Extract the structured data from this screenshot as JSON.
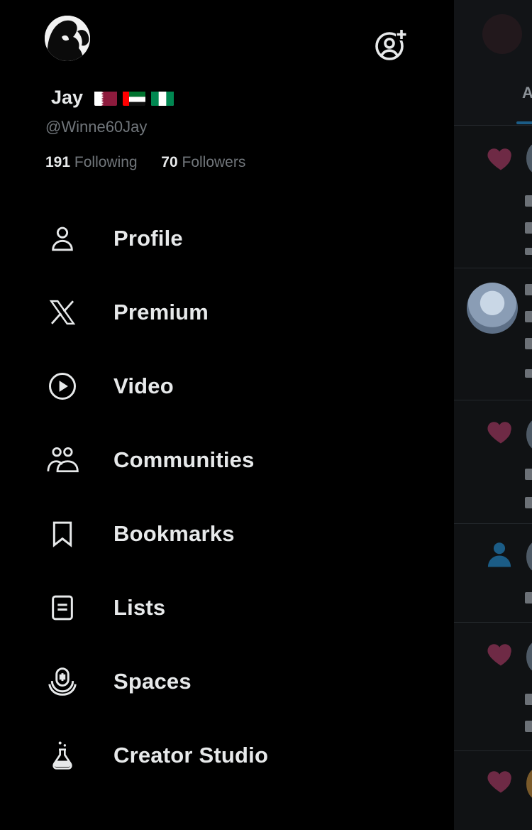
{
  "profile": {
    "display_name_parts": [
      "",
      "Jay",
      ""
    ],
    "handle": "@Winne60Jay",
    "following_count": "191",
    "following_label": "Following",
    "followers_count": "70",
    "followers_label": "Followers"
  },
  "flags": [
    "qatar",
    "uae",
    "nigeria"
  ],
  "header": {
    "add_account_icon": "person-add-icon"
  },
  "menu": [
    {
      "label": "Profile",
      "icon": "person-icon"
    },
    {
      "label": "Premium",
      "icon": "x-logo-icon"
    },
    {
      "label": "Video",
      "icon": "play-circle-icon"
    },
    {
      "label": "Communities",
      "icon": "communities-icon"
    },
    {
      "label": "Bookmarks",
      "icon": "bookmark-icon"
    },
    {
      "label": "Lists",
      "icon": "list-icon"
    },
    {
      "label": "Spaces",
      "icon": "spaces-mic-icon"
    },
    {
      "label": "Creator Studio",
      "icon": "flask-icon"
    }
  ],
  "feed": {
    "tab_label": "A"
  },
  "colors": {
    "drawer_bg": "#000000",
    "primary_text": "#e7e9ea",
    "secondary_text": "#71767b",
    "heart": "#6e2a45",
    "accent": "#1d9bf0"
  }
}
